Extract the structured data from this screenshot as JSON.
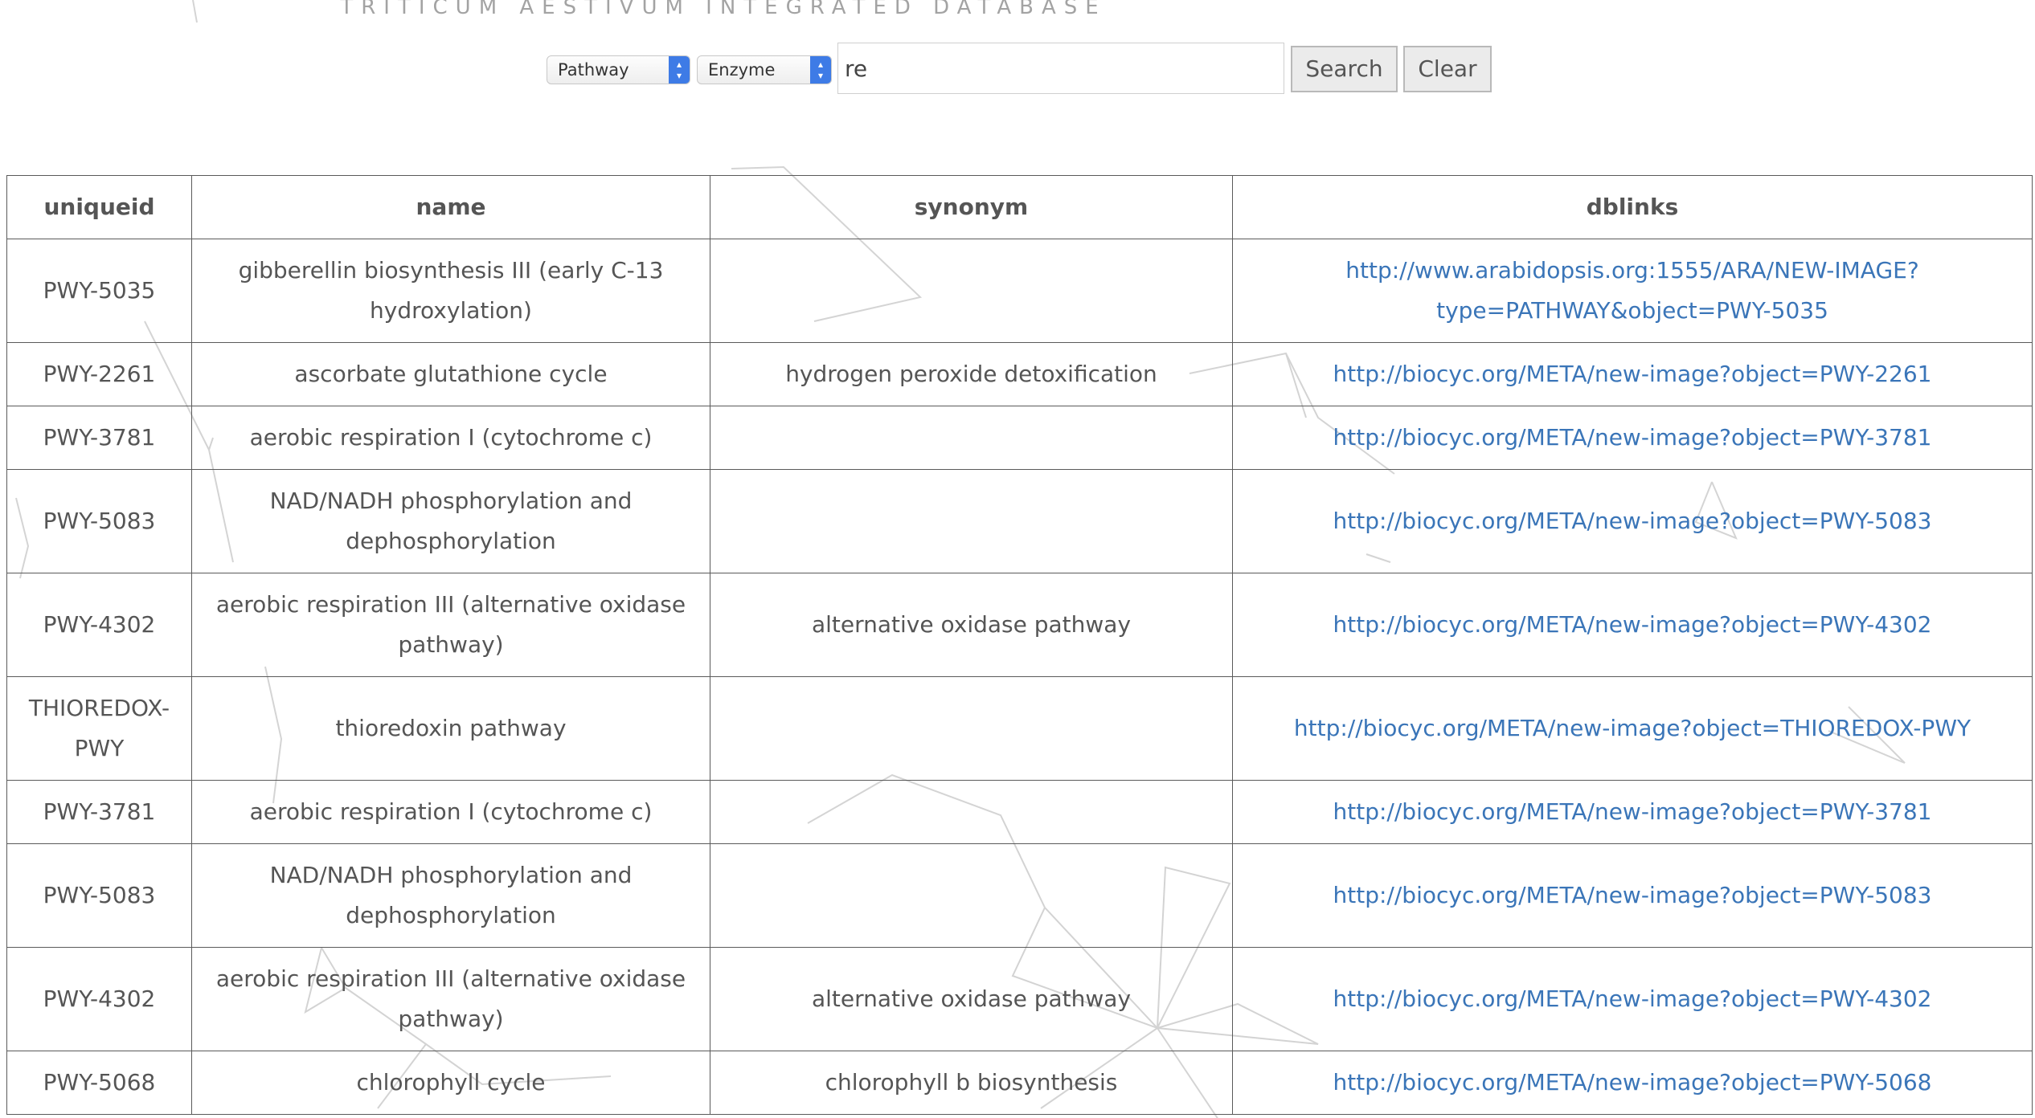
{
  "page": {
    "title": "TRITICUM AESTIVUM INTEGRATED DATABASE"
  },
  "search": {
    "type_select": "Pathway",
    "field_select": "Enzyme",
    "query": "re",
    "search_label": "Search",
    "clear_label": "Clear"
  },
  "table": {
    "headers": [
      "uniqueid",
      "name",
      "synonym",
      "dblinks"
    ],
    "rows": [
      {
        "uniqueid": "PWY-5035",
        "name": "gibberellin biosynthesis III (early C-13 hydroxylation)",
        "synonym": "",
        "dblinks": "http://www.arabidopsis.org:1555/ARA/NEW-IMAGE?type=PATHWAY&object=PWY-5035"
      },
      {
        "uniqueid": "PWY-2261",
        "name": "ascorbate glutathione cycle",
        "synonym": "hydrogen peroxide detoxification",
        "dblinks": "http://biocyc.org/META/new-image?object=PWY-2261"
      },
      {
        "uniqueid": "PWY-3781",
        "name": "aerobic respiration I (cytochrome c)",
        "synonym": "",
        "dblinks": "http://biocyc.org/META/new-image?object=PWY-3781"
      },
      {
        "uniqueid": "PWY-5083",
        "name": "NAD/NADH phosphorylation and dephosphorylation",
        "synonym": "",
        "dblinks": "http://biocyc.org/META/new-image?object=PWY-5083"
      },
      {
        "uniqueid": "PWY-4302",
        "name": "aerobic respiration III (alternative oxidase pathway)",
        "synonym": "alternative oxidase pathway",
        "dblinks": "http://biocyc.org/META/new-image?object=PWY-4302"
      },
      {
        "uniqueid": "THIOREDOX-PWY",
        "name": "thioredoxin pathway",
        "synonym": "",
        "dblinks": "http://biocyc.org/META/new-image?object=THIOREDOX-PWY"
      },
      {
        "uniqueid": "PWY-3781",
        "name": "aerobic respiration I (cytochrome c)",
        "synonym": "",
        "dblinks": "http://biocyc.org/META/new-image?object=PWY-3781"
      },
      {
        "uniqueid": "PWY-5083",
        "name": "NAD/NADH phosphorylation and dephosphorylation",
        "synonym": "",
        "dblinks": "http://biocyc.org/META/new-image?object=PWY-5083"
      },
      {
        "uniqueid": "PWY-4302",
        "name": "aerobic respiration III (alternative oxidase pathway)",
        "synonym": "alternative oxidase pathway",
        "dblinks": "http://biocyc.org/META/new-image?object=PWY-4302"
      },
      {
        "uniqueid": "PWY-5068",
        "name": "chlorophyll cycle",
        "synonym": "chlorophyll b biosynthesis",
        "dblinks": "http://biocyc.org/META/new-image?object=PWY-5068"
      }
    ]
  },
  "colors": {
    "link": "#3a75b8",
    "text": "#555555",
    "title": "#a3a3a3",
    "select_accent": "#3e7be6"
  }
}
